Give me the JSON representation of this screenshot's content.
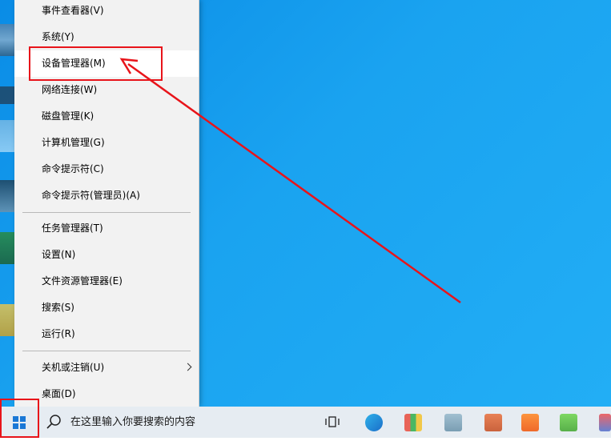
{
  "menu": {
    "items": [
      {
        "label": "事件查看器(V)"
      },
      {
        "label": "系统(Y)"
      },
      {
        "label": "设备管理器(M)"
      },
      {
        "label": "网络连接(W)"
      },
      {
        "label": "磁盘管理(K)"
      },
      {
        "label": "计算机管理(G)"
      },
      {
        "label": "命令提示符(C)"
      },
      {
        "label": "命令提示符(管理员)(A)"
      },
      {
        "label": "任务管理器(T)"
      },
      {
        "label": "设置(N)"
      },
      {
        "label": "文件资源管理器(E)"
      },
      {
        "label": "搜索(S)"
      },
      {
        "label": "运行(R)"
      },
      {
        "label": "关机或注销(U)"
      },
      {
        "label": "桌面(D)"
      }
    ],
    "highlighted": "设备管理器(M)"
  },
  "taskbar": {
    "search_placeholder": "在这里输入你要搜索的内容",
    "icons": [
      "windows-start-icon",
      "search-icon",
      "task-view-icon",
      "edge-browser-icon",
      "app-icon-2",
      "app-icon-3",
      "office-app-icon",
      "app-icon-5",
      "wechat-icon",
      "app-icon-7"
    ]
  },
  "colors": {
    "desktop": "#0a8ce6",
    "annotation": "#e8141a",
    "menu_bg": "#f2f2f2",
    "taskbar_bg": "#e6ecf2"
  }
}
